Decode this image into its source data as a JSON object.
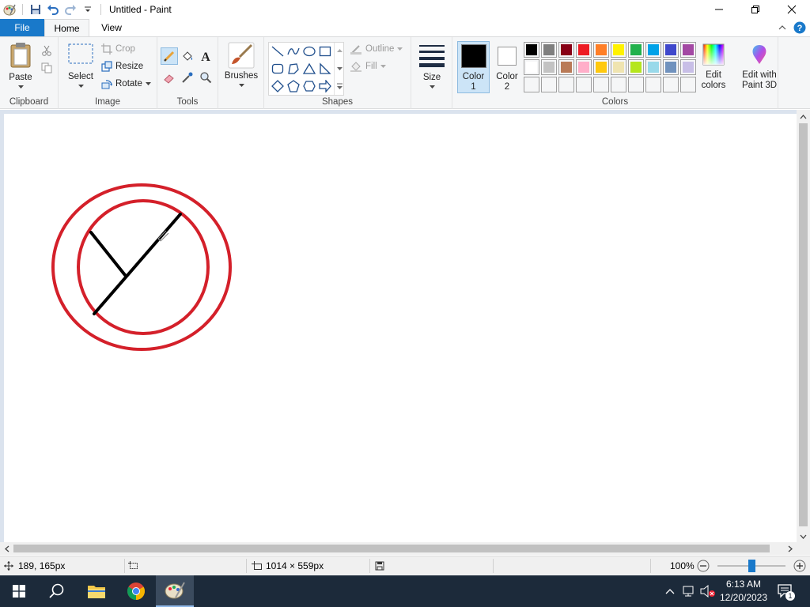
{
  "window": {
    "title": "Untitled - Paint"
  },
  "tabs": [
    {
      "label": "File"
    },
    {
      "label": "Home"
    },
    {
      "label": "View"
    }
  ],
  "clipboard": {
    "paste": "Paste",
    "group_label": "Clipboard"
  },
  "image": {
    "select": "Select",
    "crop": "Crop",
    "resize": "Resize",
    "rotate": "Rotate",
    "group_label": "Image"
  },
  "tools": {
    "group_label": "Tools"
  },
  "brushes": {
    "label": "Brushes"
  },
  "shapes": {
    "outline": "Outline",
    "fill": "Fill",
    "group_label": "Shapes"
  },
  "size": {
    "label": "Size"
  },
  "colors": {
    "color1_label": "Color",
    "color1_num": "1",
    "color2_label": "Color",
    "color2_num": "2",
    "edit_colors_line1": "Edit",
    "edit_colors_line2": "colors",
    "group_label": "Colors",
    "color1_value": "#000000",
    "color2_value": "#ffffff",
    "palette_row1": [
      "#000000",
      "#7f7f7f",
      "#880015",
      "#ed1c24",
      "#ff7f27",
      "#fff200",
      "#22b14c",
      "#00a2e8",
      "#3f48cc",
      "#a349a4"
    ],
    "palette_row2": [
      "#ffffff",
      "#c3c3c3",
      "#b97a57",
      "#ffaec9",
      "#ffc90e",
      "#efe4b0",
      "#b5e61d",
      "#99d9ea",
      "#7092be",
      "#c8bfe7"
    ],
    "palette_row3": [
      "#f5f6f7",
      "#f5f6f7",
      "#f5f6f7",
      "#f5f6f7",
      "#f5f6f7",
      "#f5f6f7",
      "#f5f6f7",
      "#f5f6f7",
      "#f5f6f7",
      "#f5f6f7"
    ]
  },
  "paint3d": {
    "line1": "Edit with",
    "line2": "Paint 3D"
  },
  "drawing": {
    "circle_color": "#d4202a",
    "line_color": "#000000"
  },
  "status": {
    "cursor_pos": "189, 165px",
    "canvas_size": "1014 × 559px",
    "zoom": "100%",
    "zoom_level": 0.5
  },
  "taskbar": {
    "time": "6:13 AM",
    "date": "12/20/2023",
    "notifications": "1"
  }
}
